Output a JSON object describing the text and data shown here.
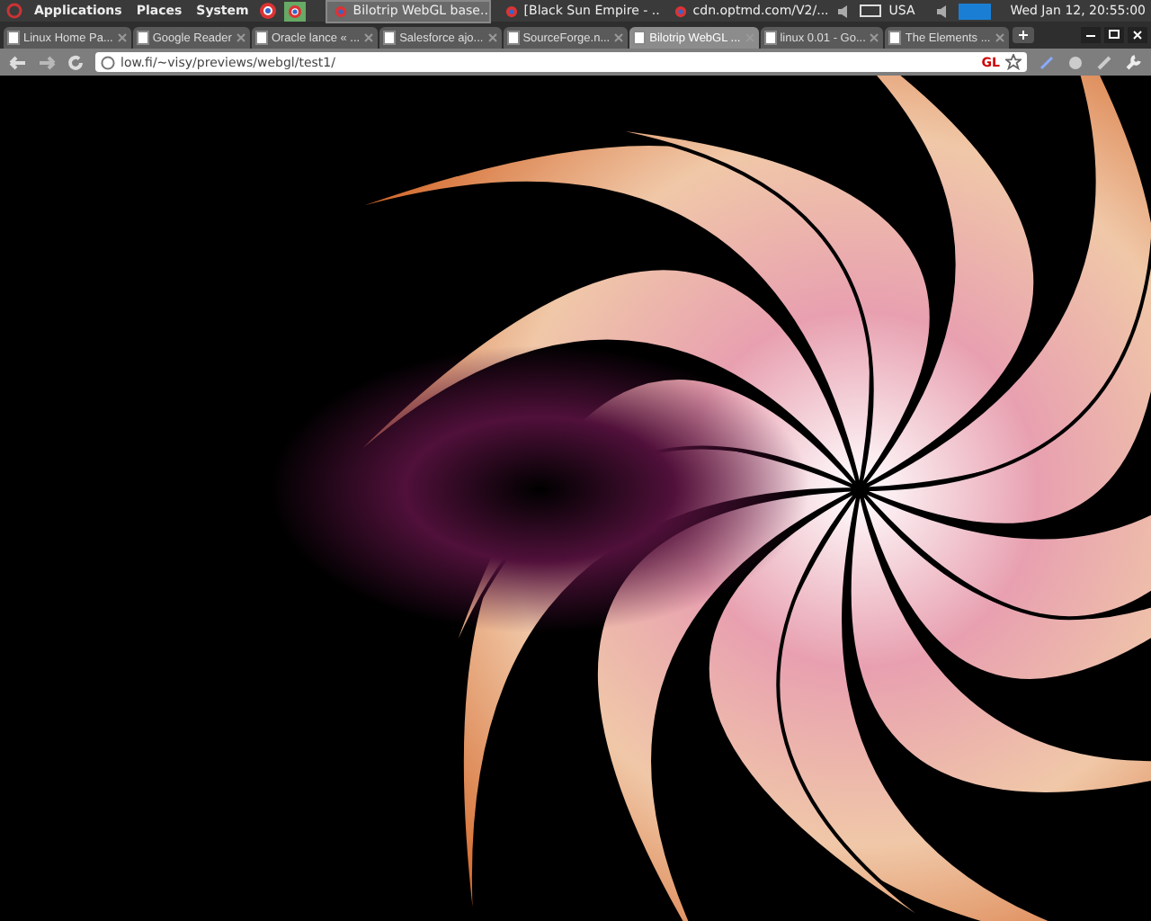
{
  "top_panel": {
    "menus": [
      "Applications",
      "Places",
      "System"
    ],
    "tasks": [
      {
        "label": "Bilotrip WebGL base...",
        "selected": true
      },
      {
        "label": "[Black Sun Empire - ...",
        "selected": false
      },
      {
        "label": "cdn.optmd.com/V2/...",
        "selected": false
      }
    ],
    "keyboard_layout": "USA",
    "clock": "Wed Jan 12, 20:55:00"
  },
  "tabs": [
    {
      "title": "Linux Home Pa...",
      "selected": false
    },
    {
      "title": "Google Reader",
      "selected": false
    },
    {
      "title": "Oracle lance « ...",
      "selected": false
    },
    {
      "title": "Salesforce ajo...",
      "selected": false
    },
    {
      "title": "SourceForge.n...",
      "selected": false
    },
    {
      "title": "Bilotrip WebGL ...",
      "selected": true
    },
    {
      "title": "linux 0.01 - Go...",
      "selected": false
    },
    {
      "title": "The Elements ...",
      "selected": false
    }
  ],
  "address_bar": {
    "url": "low.fi/~visy/previews/webgl/test1/",
    "badge": "GL"
  }
}
